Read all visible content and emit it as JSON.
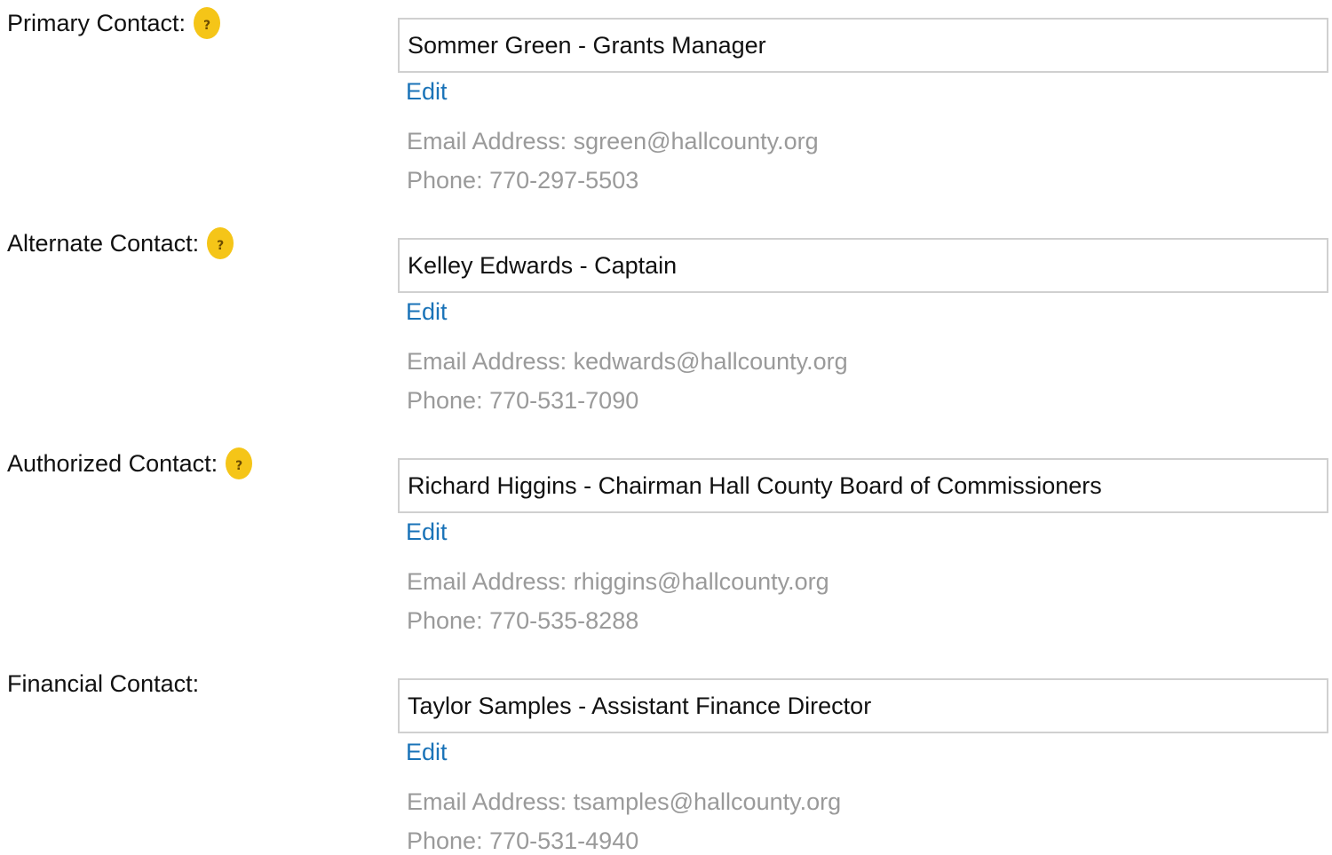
{
  "contacts": [
    {
      "label": "Primary Contact:",
      "has_help": true,
      "help_glyph": "?",
      "selected": "Sommer Green - Grants Manager",
      "edit_label": "Edit",
      "email": "Email Address: sgreen@hallcounty.org",
      "phone": "Phone: 770-297-5503"
    },
    {
      "label": "Alternate Contact:",
      "has_help": true,
      "help_glyph": "?",
      "selected": "Kelley Edwards - Captain",
      "edit_label": "Edit",
      "email": "Email Address: kedwards@hallcounty.org",
      "phone": "Phone: 770-531-7090"
    },
    {
      "label": "Authorized Contact:",
      "has_help": true,
      "help_glyph": "?",
      "selected": "Richard Higgins - Chairman Hall County Board of Commissioners",
      "edit_label": "Edit",
      "email": "Email Address: rhiggins@hallcounty.org",
      "phone": "Phone: 770-535-8288"
    },
    {
      "label": "Financial Contact:",
      "has_help": false,
      "selected": "Taylor Samples - Assistant Finance Director",
      "edit_label": "Edit",
      "email": "Email Address: tsamples@hallcounty.org",
      "phone": "Phone: 770-531-4940"
    }
  ],
  "colors": {
    "help_icon_bg": "#f5c518",
    "link": "#1a73b8",
    "detail_text": "#9a9a9a",
    "field_border": "#d0d0d0"
  }
}
